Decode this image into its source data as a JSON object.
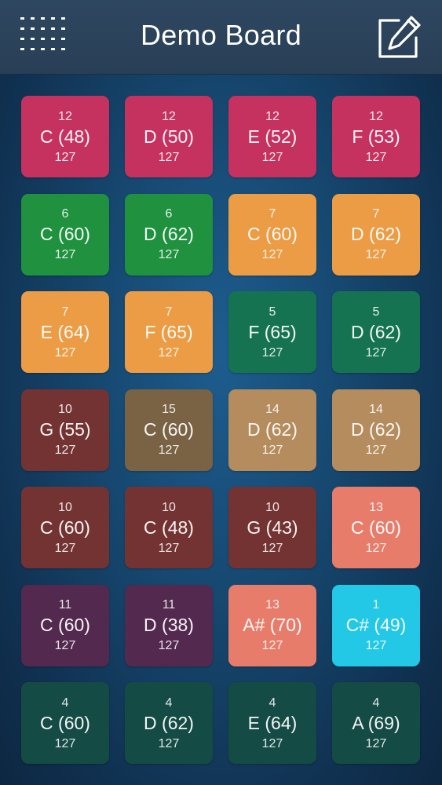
{
  "navbar": {
    "title": "Demo Board",
    "menu_icon": "grid-dots-icon",
    "edit_icon": "edit-pencil-icon"
  },
  "pads": [
    {
      "channel": "12",
      "note": "C (48)",
      "velocity": "127",
      "color": "#c5325f"
    },
    {
      "channel": "12",
      "note": "D (50)",
      "velocity": "127",
      "color": "#c5325f"
    },
    {
      "channel": "12",
      "note": "E (52)",
      "velocity": "127",
      "color": "#c5325f"
    },
    {
      "channel": "12",
      "note": "F (53)",
      "velocity": "127",
      "color": "#c5325f"
    },
    {
      "channel": "6",
      "note": "C (60)",
      "velocity": "127",
      "color": "#1f913f"
    },
    {
      "channel": "6",
      "note": "D (62)",
      "velocity": "127",
      "color": "#1f913f"
    },
    {
      "channel": "7",
      "note": "C (60)",
      "velocity": "127",
      "color": "#eb9c45"
    },
    {
      "channel": "7",
      "note": "D (62)",
      "velocity": "127",
      "color": "#eb9c45"
    },
    {
      "channel": "7",
      "note": "E (64)",
      "velocity": "127",
      "color": "#eb9c45"
    },
    {
      "channel": "7",
      "note": "F (65)",
      "velocity": "127",
      "color": "#eb9c45"
    },
    {
      "channel": "5",
      "note": "F (65)",
      "velocity": "127",
      "color": "#167352"
    },
    {
      "channel": "5",
      "note": "D (62)",
      "velocity": "127",
      "color": "#167352"
    },
    {
      "channel": "10",
      "note": "G (55)",
      "velocity": "127",
      "color": "#733333"
    },
    {
      "channel": "15",
      "note": "C (60)",
      "velocity": "127",
      "color": "#7a6244"
    },
    {
      "channel": "14",
      "note": "D (62)",
      "velocity": "127",
      "color": "#b48c5d"
    },
    {
      "channel": "14",
      "note": "D (62)",
      "velocity": "127",
      "color": "#b48c5d"
    },
    {
      "channel": "10",
      "note": "C (60)",
      "velocity": "127",
      "color": "#733333"
    },
    {
      "channel": "10",
      "note": "C (48)",
      "velocity": "127",
      "color": "#733333"
    },
    {
      "channel": "10",
      "note": "G (43)",
      "velocity": "127",
      "color": "#733333"
    },
    {
      "channel": "13",
      "note": "C (60)",
      "velocity": "127",
      "color": "#e77c6b"
    },
    {
      "channel": "11",
      "note": "C (60)",
      "velocity": "127",
      "color": "#53294f"
    },
    {
      "channel": "11",
      "note": "D (38)",
      "velocity": "127",
      "color": "#53294f"
    },
    {
      "channel": "13",
      "note": "A# (70)",
      "velocity": "127",
      "color": "#e77c6b"
    },
    {
      "channel": "1",
      "note": "C# (49)",
      "velocity": "127",
      "color": "#22c8e6"
    },
    {
      "channel": "4",
      "note": "C (60)",
      "velocity": "127",
      "color": "#154b45"
    },
    {
      "channel": "4",
      "note": "D (62)",
      "velocity": "127",
      "color": "#154b45"
    },
    {
      "channel": "4",
      "note": "E (64)",
      "velocity": "127",
      "color": "#154b45"
    },
    {
      "channel": "4",
      "note": "A (69)",
      "velocity": "127",
      "color": "#154b45"
    }
  ]
}
